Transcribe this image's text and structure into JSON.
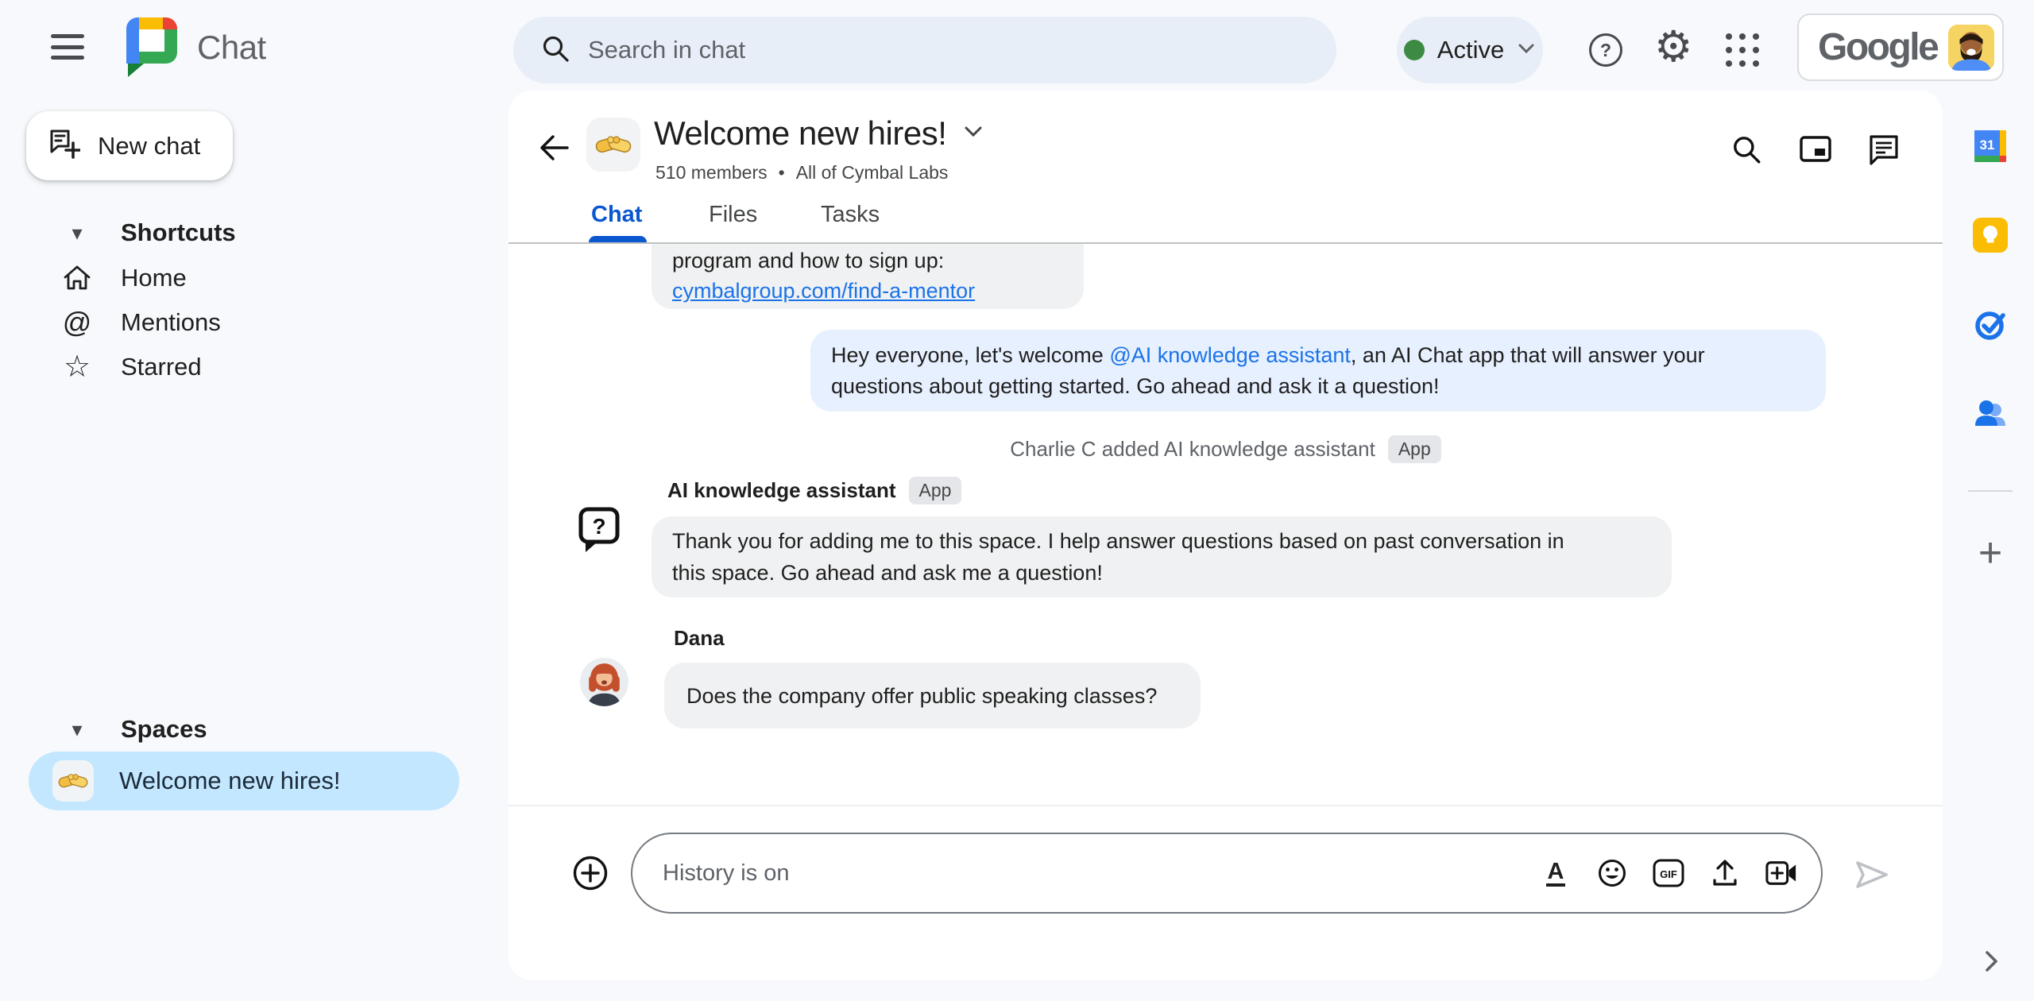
{
  "topbar": {
    "app_name": "Chat",
    "search_placeholder": "Search in chat",
    "status_label": "Active",
    "brand": "Google"
  },
  "sidebar": {
    "new_chat": "New chat",
    "shortcuts_header": "Shortcuts",
    "nav": [
      {
        "label": "Home"
      },
      {
        "label": "Mentions"
      },
      {
        "label": "Starred"
      }
    ],
    "spaces_header": "Spaces",
    "space": {
      "label": "Welcome new hires!"
    }
  },
  "header": {
    "title": "Welcome new hires!",
    "members": "510 members",
    "org": "All of Cymbal Labs",
    "tabs": [
      {
        "label": "Chat"
      },
      {
        "label": "Files"
      },
      {
        "label": "Tasks"
      }
    ]
  },
  "messages": {
    "m1": {
      "line1": "program and how to sign up:",
      "link": "cymbalgroup.com/find-a-mentor"
    },
    "m2": {
      "pre": "Hey everyone, let's welcome ",
      "mention": "@AI knowledge assistant",
      "post": ", an AI Chat app that will answer your",
      "line2": "questions about getting started.  Go ahead and ask it a question!"
    },
    "system": {
      "text": "Charlie C added AI knowledge assistant",
      "badge": "App"
    },
    "m3": {
      "sender": "AI knowledge assistant",
      "badge": "App",
      "line1": "Thank you for adding me to this space. I help answer questions based on past conversation in",
      "line2": "this space. Go ahead and ask me a question!"
    },
    "m4": {
      "sender": "Dana",
      "text": "Does the company offer public speaking classes?"
    }
  },
  "composer": {
    "placeholder": "History is on",
    "gif_label": "GIF",
    "format_glyph": "A"
  },
  "glyphs": {
    "help": "?",
    "gear": "⚙",
    "mentions": "@",
    "star": "☆",
    "triangle": "▾",
    "separator": "•",
    "ai_question": "?",
    "calendar_day": "31",
    "plus": "+"
  },
  "colors": {
    "accent_blue": "#0b57d0",
    "link_blue": "#1a73e8",
    "selected_space_bg": "#c2e7ff",
    "own_bubble_bg": "#e7f0fe",
    "bubble_bg": "#f0f1f2",
    "active_green": "#3d8a43",
    "background": "#f7f9fc",
    "pill_bg": "#e8eef7"
  }
}
